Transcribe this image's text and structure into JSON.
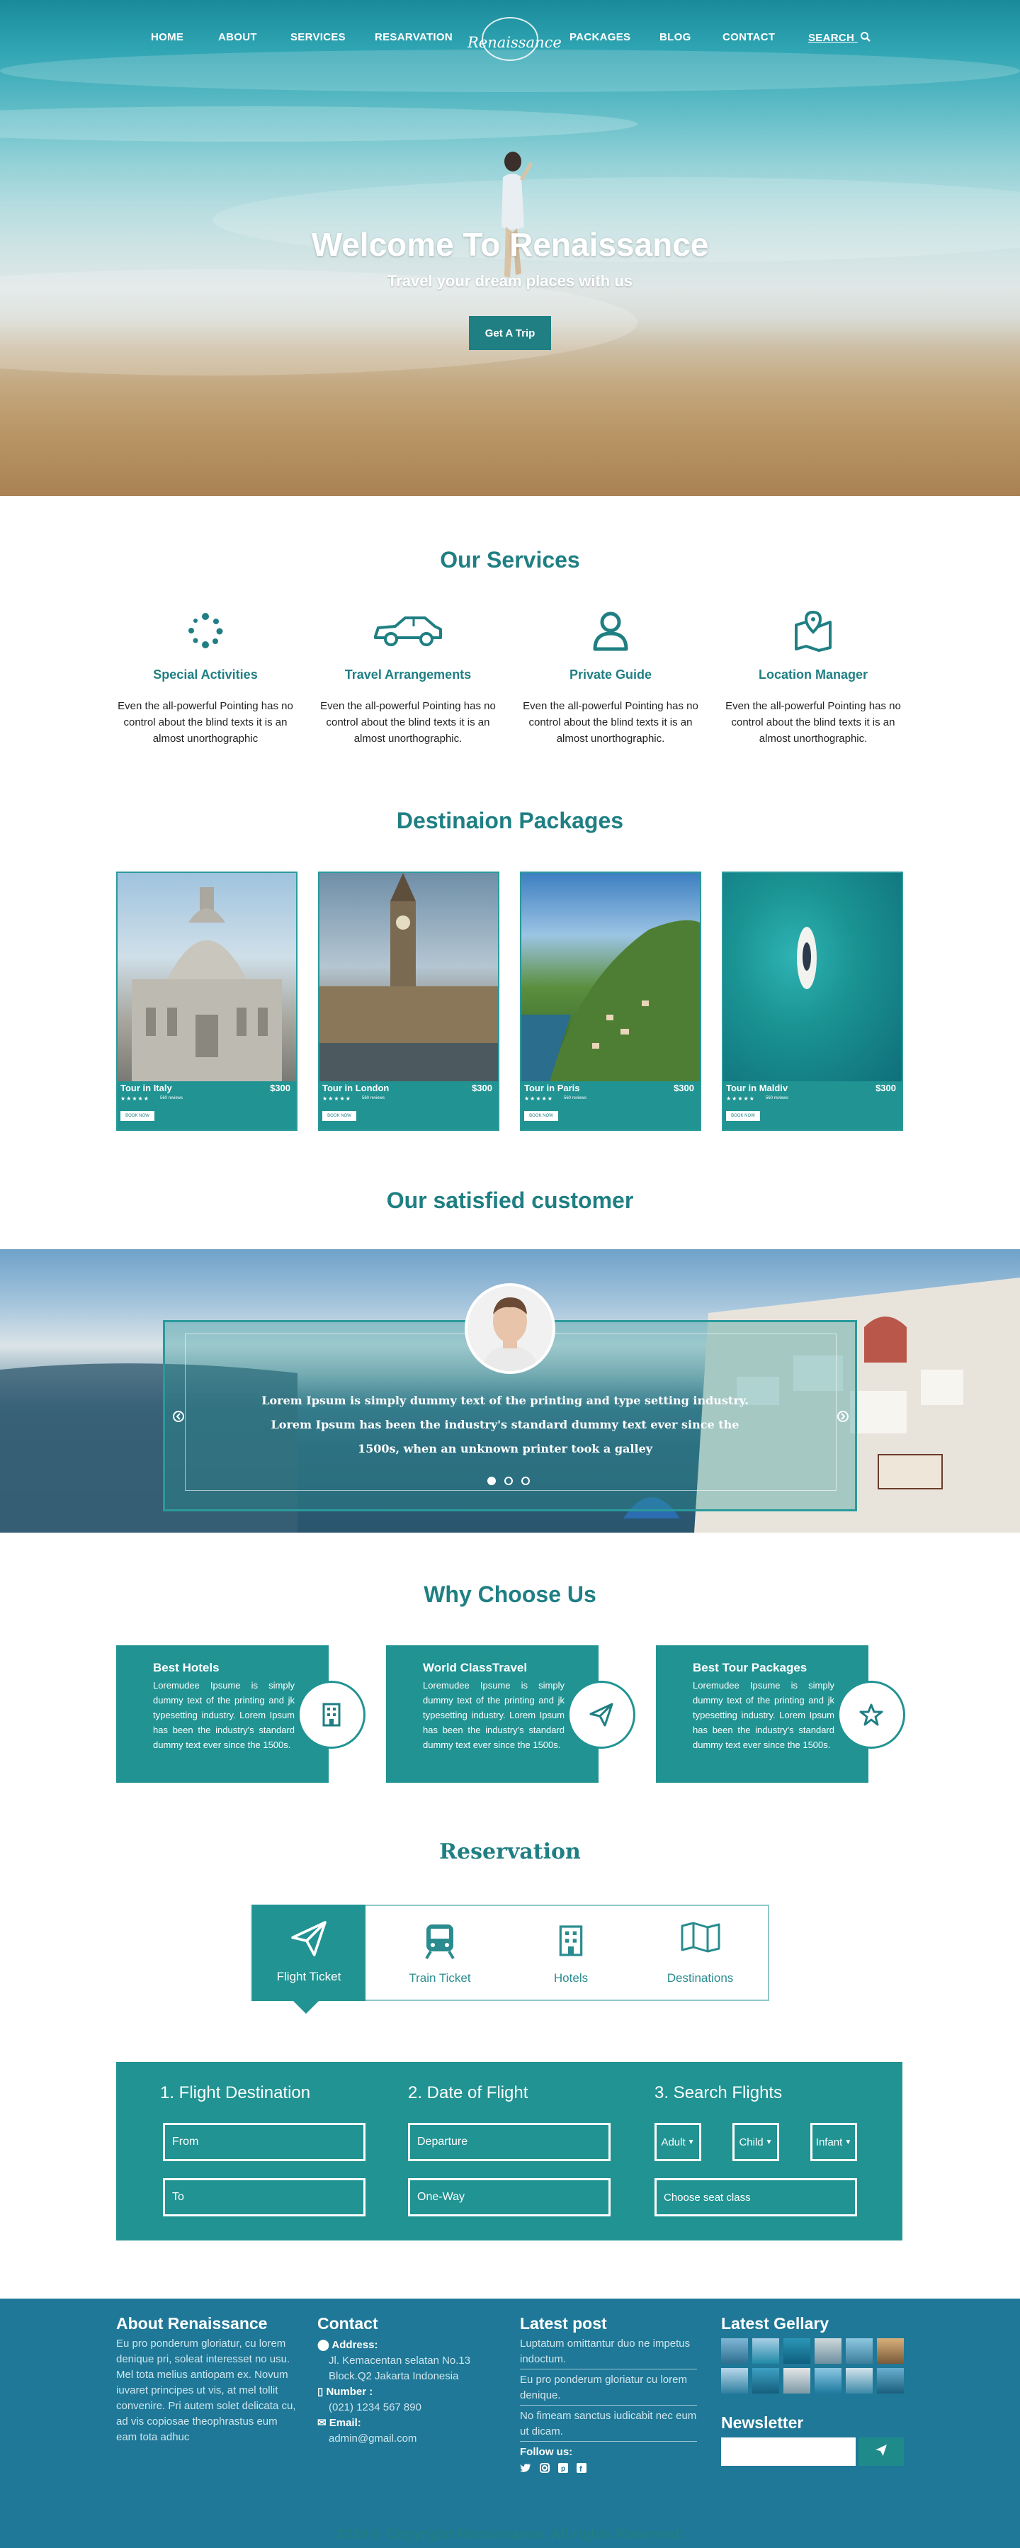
{
  "nav": {
    "items": [
      "HOME",
      "ABOUT",
      "SERVICES",
      "RESARVATION",
      "PACKAGES",
      "BLOG",
      "CONTACT"
    ],
    "search_label": "SEARCH",
    "logo_text": "Renaissance"
  },
  "hero": {
    "title": "Welcome To Renaissance",
    "subtitle": "Travel your dream places with us",
    "button": "Get A Trip"
  },
  "services": {
    "title": "Our  Services",
    "items": [
      {
        "title": "Special Activities",
        "text": "Even the all-powerful Pointing has no control about the blind texts it is an almost unorthographic",
        "icon": "dots-circle-icon"
      },
      {
        "title": "Travel Arrangements",
        "text": "Even the all-powerful Pointing has no control about the blind texts it is an almost unorthographic.",
        "icon": "car-icon"
      },
      {
        "title": "Private Guide",
        "text": "Even the all-powerful Pointing has no control about the blind texts it is an almost unorthographic.",
        "icon": "user-icon"
      },
      {
        "title": "Location Manager",
        "text": "Even the all-powerful Pointing has no control about the blind texts it is an almost unorthographic.",
        "icon": "map-pin-icon"
      }
    ]
  },
  "packages": {
    "title": "Destinaion Packages",
    "items": [
      {
        "name": "Tour in Italy",
        "price": "$300",
        "stars": "★★★★★",
        "reviews": "560 reviews",
        "button": "BOOK NOW"
      },
      {
        "name": "Tour in London",
        "price": "$300",
        "stars": "★★★★★",
        "reviews": "560 reviews",
        "button": "BOOK NOW"
      },
      {
        "name": "Tour in Paris",
        "price": "$300",
        "stars": "★★★★★",
        "reviews": "560 reviews",
        "button": "BOOK NOW"
      },
      {
        "name": "Tour in Maldiv",
        "price": "$300",
        "stars": "★★★★★",
        "reviews": "560 reviews",
        "button": "BOOK NOW"
      }
    ]
  },
  "testimonial": {
    "title": "Our satisfied customer",
    "text": "Lorem Ipsum is simply dummy text of the printing and type setting industry. Lorem Ipsum has been the industry's standard dummy text ever since the 1500s, when an unknown printer took a galley"
  },
  "why": {
    "title": "Why Choose Us",
    "items": [
      {
        "title": "Best Hotels",
        "text": "Loremudee Ipsume is simply dummy text of the printing and jk typesetting industry. Lorem Ipsum has been the industry's standard dummy text ever since the 1500s.",
        "icon": "building-icon"
      },
      {
        "title": "World ClassTravel",
        "text": "Loremudee Ipsume is simply dummy text of the printing and jk typesetting industry. Lorem Ipsum has been the industry's standard dummy text ever since the 1500s.",
        "icon": "paper-plane-icon"
      },
      {
        "title": "Best Tour Packages",
        "text": "Loremudee Ipsume is simply dummy text of the printing and jk typesetting industry. Lorem Ipsum has been the industry's standard dummy text ever since the 1500s.",
        "icon": "star-icon"
      }
    ]
  },
  "reservation": {
    "title": "Reservation",
    "tabs": [
      "Flight Ticket",
      "Train Ticket",
      "Hotels",
      "Destinations"
    ],
    "steps": [
      "1. Flight Destination",
      "2. Date of Flight",
      "3. Search Flights"
    ],
    "fields": {
      "from": "From",
      "to": "To",
      "departure": "Departure",
      "oneway": "One-Way",
      "adult": "Adult",
      "child": "Child",
      "infant": "Infant",
      "seat": "Choose seat class"
    }
  },
  "footer": {
    "about_title": "About Renaissance",
    "about_text": "Eu pro ponderum gloriatur, cu lorem denique pri, soleat interesset no usu. Mel tota melius antiopam ex. Novum iuvaret principes ut vis, at mel tollit convenire. Pri autem solet delicata cu, ad vis copiosae theophrastus eum eam tota adhuc",
    "contact_title": "Contact",
    "address_label": "Address:",
    "address": "Jl. Kemacentan selatan No.13 Block.Q2 Jakarta Indonesia",
    "number_label": "Number :",
    "number": "(021) 1234 567 890",
    "email_label": "Email:",
    "email": "admin@gmail.com",
    "latest_title": "Latest post",
    "posts": [
      "Luptatum omittantur duo ne impetus indoctum.",
      "Eu pro ponderum gloriatur cu lorem denique.",
      "No fimeam sanctus iudicabit nec eum ut dicam."
    ],
    "follow": "Follow us:",
    "gallery_title": "Latest Gellary",
    "newsletter_title": "Newsletter",
    "copyright": "2019 © Copyright Renaissance. All rights Reserved."
  },
  "colors": {
    "primary": "#219393",
    "footer": "#1f7897"
  }
}
